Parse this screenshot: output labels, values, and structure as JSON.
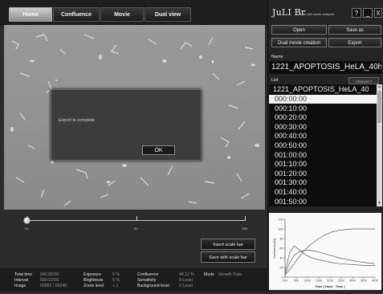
{
  "tabs": [
    {
      "label": "Home",
      "active": true
    },
    {
      "label": "Confluence",
      "active": false
    },
    {
      "label": "Movie",
      "active": false
    },
    {
      "label": "Dual view",
      "active": false
    }
  ],
  "dialog": {
    "message": "Export is complete.",
    "ok_label": "OK"
  },
  "slider": {
    "ticks": [
      "1x",
      "4x",
      "10x"
    ],
    "value_fraction": 0.0
  },
  "buttons": {
    "insert_scale_bar": "Insert scale bar",
    "save_with_scale_bar": "Save with scale bar"
  },
  "info": {
    "total_time_label": "Total time",
    "total_time": "040:00:00",
    "interval_label": "Interval",
    "interval": "000:10:00",
    "image_label": "Image",
    "image": "00001 / 00240",
    "exposure_label": "Exposure",
    "exposure": "5 %",
    "brightness_label": "Brightness",
    "brightness": "5 %",
    "zoom_label": "Zoom level",
    "zoom": "+ 1",
    "confluence_label": "Confluence",
    "confluence": "44.11 %",
    "sensitivity_label": "Sensitivity",
    "sensitivity": "9 Level",
    "background_label": "Background level",
    "background": "2 Level",
    "mode_label": "Mode",
    "mode": "Growth Rate"
  },
  "app": {
    "logo": "JuLI Br",
    "tagline": "Live cell movie analyzer",
    "help": "?",
    "minimize": "_",
    "close": "X"
  },
  "panel": {
    "open": "Open",
    "save_as": "Save as",
    "dual_movie": "Dual movie creation",
    "export": "Export",
    "name_label": "Name",
    "name_value": "1221_APOPTOSIS_HeLA_40hr",
    "list_label": "List",
    "channel": "Channel 1",
    "list_header": "1221_APOPTOSIS_HeLA_40",
    "items": [
      "000:00:00",
      "000:10:00",
      "000:20:00",
      "000:30:00",
      "000:40:00",
      "000:50:00",
      "001:00:00",
      "001:10:00",
      "001:20:00",
      "001:30:00",
      "001:40:00",
      "001:50:00"
    ],
    "selected_index": 0
  },
  "chart_data": {
    "type": "line",
    "title": "",
    "xlabel": "Time ( Hour : Time )",
    "ylabel": "Confluence(%)",
    "ylim": [
      0,
      120
    ],
    "yticks": [
      0,
      20,
      40,
      60,
      80,
      100,
      120
    ],
    "xticks": [
      "0:00",
      "5:00",
      "10:00",
      "15:00",
      "20:00",
      "25:00",
      "30:00",
      "35:00",
      "40:00"
    ],
    "x": [
      0,
      2,
      4,
      6,
      8,
      10,
      12,
      15,
      18,
      21,
      24,
      27,
      30,
      33,
      36,
      40
    ],
    "series": [
      {
        "values": [
          5,
          30,
          45,
          52,
          55,
          56,
          55,
          52,
          48,
          44,
          40,
          37,
          34,
          32,
          30,
          28
        ]
      },
      {
        "values": [
          5,
          15,
          28,
          40,
          52,
          62,
          70,
          80,
          88,
          94,
          97,
          99,
          100,
          100,
          100,
          100
        ]
      },
      {
        "values": [
          10,
          50,
          65,
          58,
          50,
          44,
          40,
          36,
          33,
          30,
          28,
          27,
          26,
          25,
          24,
          24
        ]
      }
    ],
    "colors": {
      "lines": "#555555",
      "axis": "#333333",
      "background": "#fafafa"
    }
  }
}
